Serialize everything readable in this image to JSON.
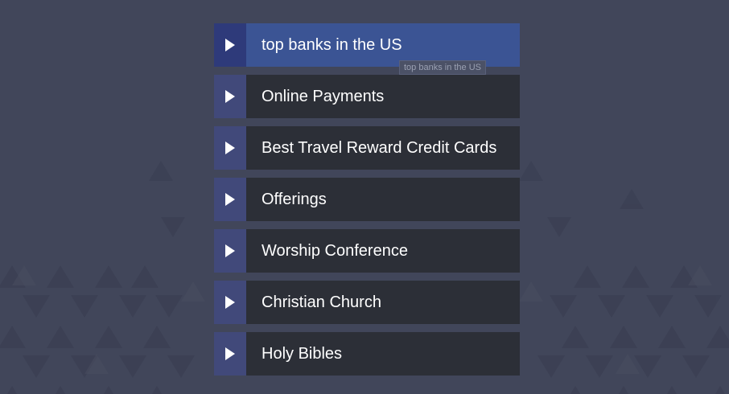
{
  "colors": {
    "background": "#41465a",
    "arrow_box": "#41497a",
    "label_box": "#2c2f37",
    "active_label_box": "#3b5494",
    "text": "#ffffff"
  },
  "links": [
    {
      "label": "top banks in the US",
      "icon": "play-icon",
      "active": true
    },
    {
      "label": "Online Payments",
      "icon": "play-icon"
    },
    {
      "label": "Best Travel Reward Credit Cards",
      "icon": "play-icon"
    },
    {
      "label": "Offerings",
      "icon": "play-icon"
    },
    {
      "label": "Worship Conference",
      "icon": "play-icon"
    },
    {
      "label": "Christian Church",
      "icon": "play-icon"
    },
    {
      "label": "Holy Bibles",
      "icon": "play-icon"
    }
  ],
  "tooltip": {
    "text": "top banks in the US"
  }
}
